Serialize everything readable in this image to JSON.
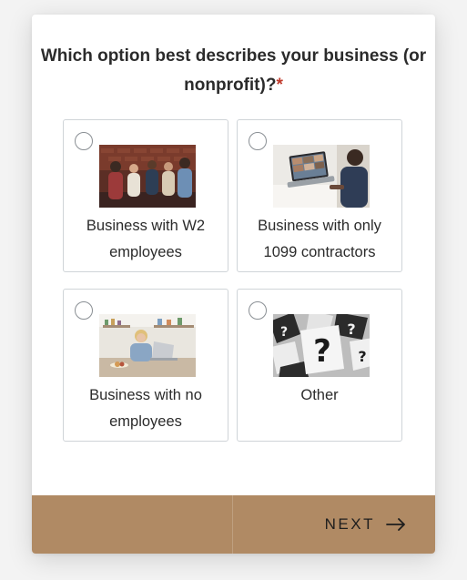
{
  "question": {
    "text": "Which option best describes your business (or nonprofit)?",
    "required_mark": "*"
  },
  "options": [
    {
      "label": "Business with W2 employees",
      "image": "team-meeting-photo-icon"
    },
    {
      "label": "Business with only 1099 contractors",
      "image": "video-call-laptop-photo-icon"
    },
    {
      "label": "Business with no employees",
      "image": "woman-at-laptop-photo-icon"
    },
    {
      "label": "Other",
      "image": "question-marks-photo-icon"
    }
  ],
  "footer": {
    "next_label": "NEXT"
  },
  "colors": {
    "footer_bg": "#b08a64",
    "required": "#c0392b",
    "border": "#cfd4d8"
  }
}
